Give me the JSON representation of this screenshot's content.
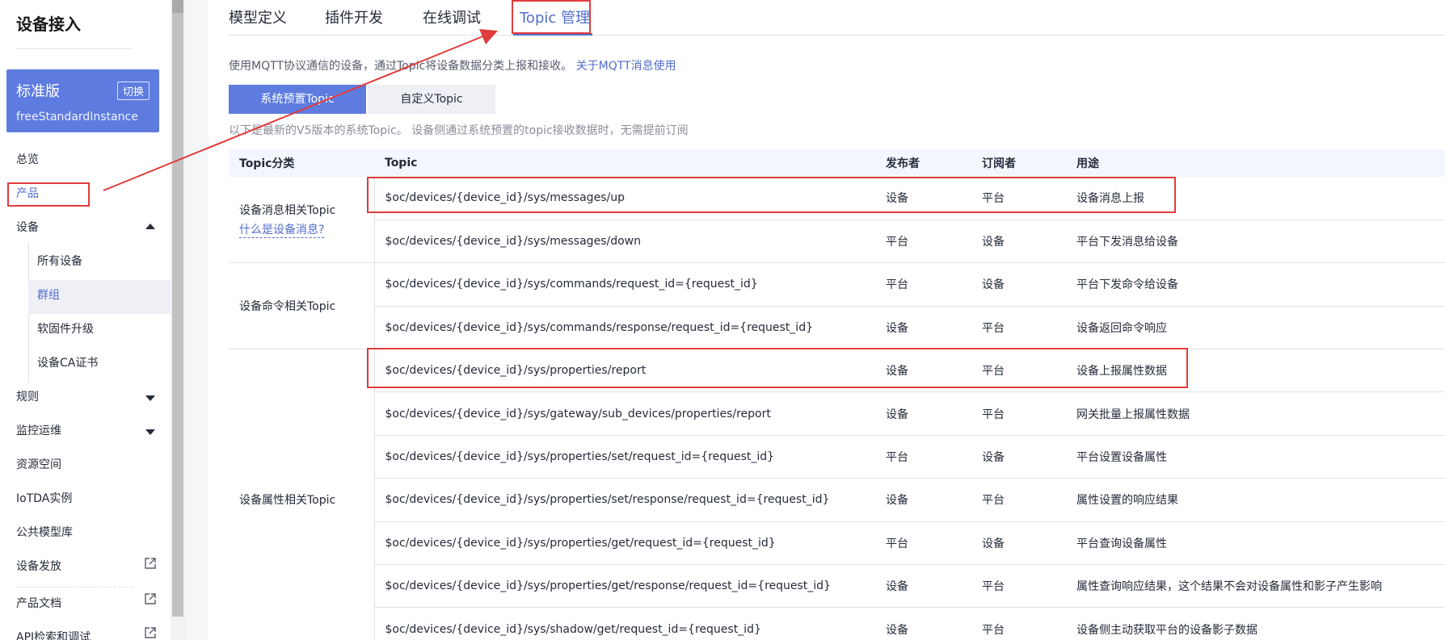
{
  "sidebar": {
    "title": "设备接入",
    "edition": {
      "name": "标准版",
      "switch_label": "切换",
      "instance": "freeStandardInstance"
    },
    "items": [
      {
        "label": "总览"
      },
      {
        "label": "产品"
      },
      {
        "label": "设备"
      },
      {
        "label": "所有设备"
      },
      {
        "label": "群组"
      },
      {
        "label": "软固件升级"
      },
      {
        "label": "设备CA证书"
      },
      {
        "label": "规则"
      },
      {
        "label": "监控运维"
      },
      {
        "label": "资源空间"
      },
      {
        "label": "IoTDA实例"
      },
      {
        "label": "公共模型库"
      },
      {
        "label": "设备发放"
      },
      {
        "label": "产品文档"
      },
      {
        "label": "API检索和调试"
      }
    ]
  },
  "tabs": [
    {
      "label": "模型定义"
    },
    {
      "label": "插件开发"
    },
    {
      "label": "在线调试"
    },
    {
      "label": "Topic 管理"
    }
  ],
  "description": {
    "text": "使用MQTT协议通信的设备，通过Topic将设备数据分类上报和接收。",
    "link": "关于MQTT消息使用"
  },
  "subtabs": {
    "system": "系统预置Topic",
    "custom": "自定义Topic"
  },
  "note": "以下是最新的V5版本的系统Topic。 设备侧通过系统预置的topic接收数据时，无需提前订阅",
  "table": {
    "headers": [
      "Topic分类",
      "Topic",
      "发布者",
      "订阅者",
      "用途"
    ],
    "categories": {
      "messages": {
        "label": "设备消息相关Topic",
        "link": "什么是设备消息?"
      },
      "commands": {
        "label": "设备命令相关Topic"
      },
      "properties": {
        "label": "设备属性相关Topic"
      }
    },
    "rows": [
      {
        "topic": "$oc/devices/{device_id}/sys/messages/up",
        "publisher": "设备",
        "subscriber": "平台",
        "usage": "设备消息上报"
      },
      {
        "topic": "$oc/devices/{device_id}/sys/messages/down",
        "publisher": "平台",
        "subscriber": "设备",
        "usage": "平台下发消息给设备"
      },
      {
        "topic": "$oc/devices/{device_id}/sys/commands/request_id={request_id}",
        "publisher": "平台",
        "subscriber": "设备",
        "usage": "平台下发命令给设备"
      },
      {
        "topic": "$oc/devices/{device_id}/sys/commands/response/request_id={request_id}",
        "publisher": "设备",
        "subscriber": "平台",
        "usage": "设备返回命令响应"
      },
      {
        "topic": "$oc/devices/{device_id}/sys/properties/report",
        "publisher": "设备",
        "subscriber": "平台",
        "usage": "设备上报属性数据"
      },
      {
        "topic": "$oc/devices/{device_id}/sys/gateway/sub_devices/properties/report",
        "publisher": "设备",
        "subscriber": "平台",
        "usage": "网关批量上报属性数据"
      },
      {
        "topic": "$oc/devices/{device_id}/sys/properties/set/request_id={request_id}",
        "publisher": "平台",
        "subscriber": "设备",
        "usage": "平台设置设备属性"
      },
      {
        "topic": "$oc/devices/{device_id}/sys/properties/set/response/request_id={request_id}",
        "publisher": "设备",
        "subscriber": "平台",
        "usage": "属性设置的响应结果"
      },
      {
        "topic": "$oc/devices/{device_id}/sys/properties/get/request_id={request_id}",
        "publisher": "平台",
        "subscriber": "设备",
        "usage": "平台查询设备属性"
      },
      {
        "topic": "$oc/devices/{device_id}/sys/properties/get/response/request_id={request_id}",
        "publisher": "设备",
        "subscriber": "平台",
        "usage": "属性查询响应结果，这个结果不会对设备属性和影子产生影响"
      },
      {
        "topic": "$oc/devices/{device_id}/sys/shadow/get/request_id={request_id}",
        "publisher": "设备",
        "subscriber": "平台",
        "usage": "设备侧主动获取平台的设备影子数据"
      }
    ]
  },
  "colors": {
    "accent": "#526ecc",
    "edition_bg": "#5e7ce0",
    "annotation": "#e03c3c"
  }
}
